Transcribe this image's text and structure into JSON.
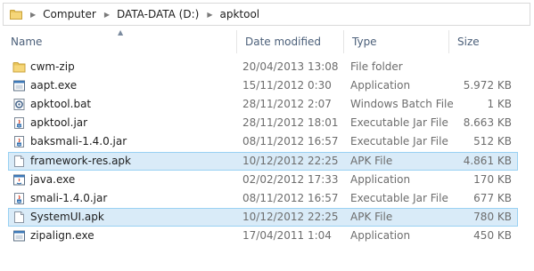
{
  "breadcrumb": [
    "Computer",
    "DATA-DATA (D:)",
    "apktool"
  ],
  "columns": {
    "name": "Name",
    "date": "Date modified",
    "type": "Type",
    "size": "Size"
  },
  "files": [
    {
      "name": "cwm-zip",
      "date": "20/04/2013 13:08",
      "type": "File folder",
      "size": "",
      "icon": "folder-icon",
      "selected": false
    },
    {
      "name": "aapt.exe",
      "date": "15/11/2012 0:30",
      "type": "Application",
      "size": "5.972 KB",
      "icon": "application-icon",
      "selected": false
    },
    {
      "name": "apktool.bat",
      "date": "28/11/2012 2:07",
      "type": "Windows Batch File",
      "size": "1 KB",
      "icon": "batch-file-icon",
      "selected": false
    },
    {
      "name": "apktool.jar",
      "date": "28/11/2012 18:01",
      "type": "Executable Jar File",
      "size": "8.663 KB",
      "icon": "jar-file-icon",
      "selected": false
    },
    {
      "name": "baksmali-1.4.0.jar",
      "date": "08/11/2012 16:57",
      "type": "Executable Jar File",
      "size": "512 KB",
      "icon": "jar-file-icon",
      "selected": false
    },
    {
      "name": "framework-res.apk",
      "date": "10/12/2012 22:25",
      "type": "APK File",
      "size": "4.861 KB",
      "icon": "blank-file-icon",
      "selected": true
    },
    {
      "name": "java.exe",
      "date": "02/02/2012 17:33",
      "type": "Application",
      "size": "170 KB",
      "icon": "java-application-icon",
      "selected": false
    },
    {
      "name": "smali-1.4.0.jar",
      "date": "08/11/2012 16:57",
      "type": "Executable Jar File",
      "size": "677 KB",
      "icon": "jar-file-icon",
      "selected": false
    },
    {
      "name": "SystemUI.apk",
      "date": "10/12/2012 22:25",
      "type": "APK File",
      "size": "780 KB",
      "icon": "blank-file-icon",
      "selected": true
    },
    {
      "name": "zipalign.exe",
      "date": "17/04/2011 1:04",
      "type": "Application",
      "size": "450 KB",
      "icon": "application-icon",
      "selected": false
    }
  ]
}
